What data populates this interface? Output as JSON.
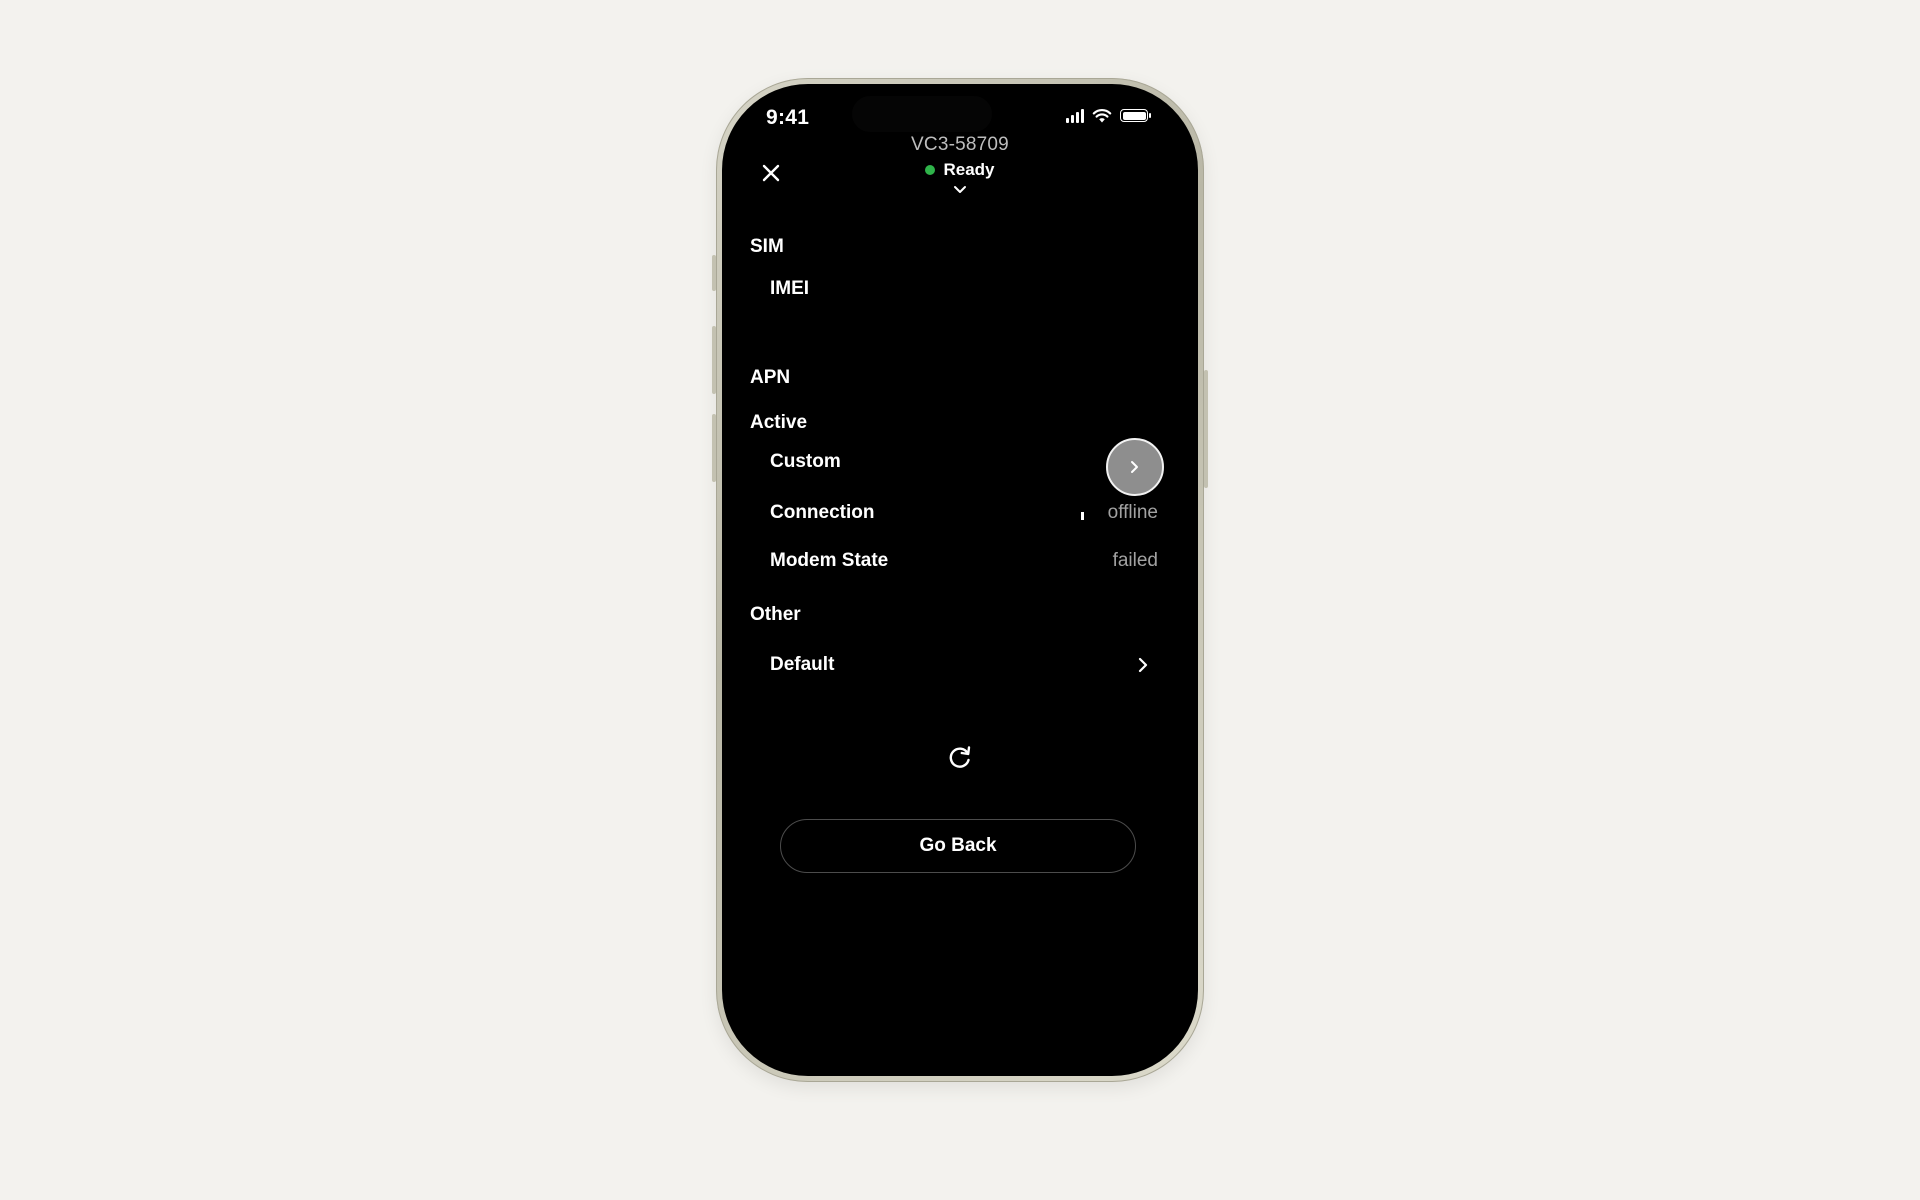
{
  "status_bar": {
    "time": "9:41",
    "icons": [
      "cellular-signal-icon",
      "wifi-icon",
      "battery-icon"
    ]
  },
  "header": {
    "close_icon": "close-icon",
    "device_id": "VC3-58709",
    "status": "Ready",
    "status_color": "#2fb34a",
    "expand_icon": "chevron-down-icon"
  },
  "sim": {
    "heading": "SIM",
    "imei_label": "IMEI",
    "imei_value": ""
  },
  "apn": {
    "heading": "APN",
    "active_heading": "Active",
    "custom_label": "Custom",
    "connection_label": "Connection",
    "connection_value": "offline",
    "modem_state_label": "Modem State",
    "modem_state_value": "failed",
    "other_heading": "Other",
    "default_label": "Default"
  },
  "actions": {
    "refresh_icon": "refresh-icon",
    "go_back_label": "Go Back"
  },
  "colors": {
    "page_background": "#f3f2ee",
    "screen_background": "#000000",
    "muted_text": "#a2a2a2",
    "button_border": "#4c4c4c"
  }
}
